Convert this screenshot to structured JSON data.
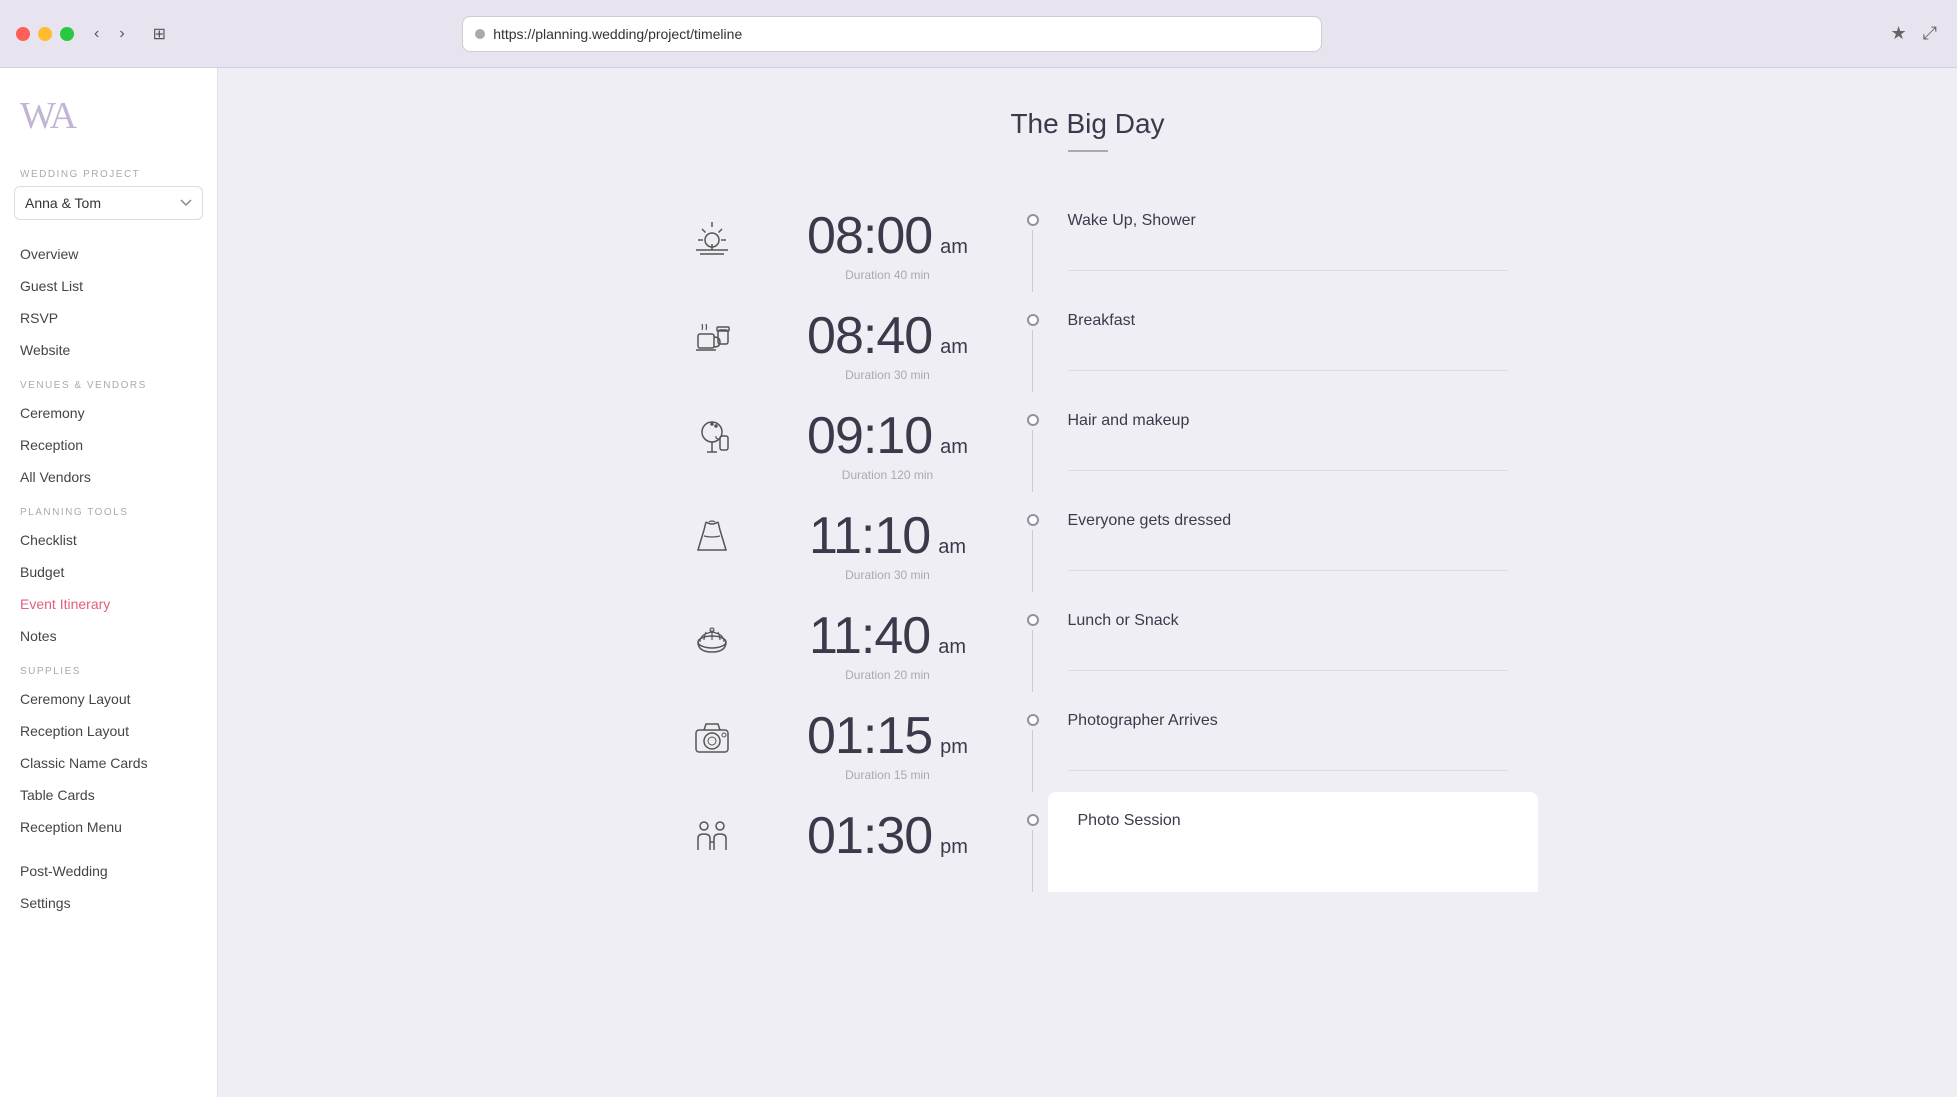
{
  "browser": {
    "url": "https://planning.wedding/project/timeline",
    "bookmark_icon": "★",
    "expand_icon": "⤢"
  },
  "sidebar": {
    "logo_text": "WA",
    "project_section_label": "WEDDING PROJECT",
    "project_name": "Anna & Tom",
    "nav_sections": [
      {
        "items": [
          {
            "id": "overview",
            "label": "Overview",
            "active": false
          },
          {
            "id": "guest-list",
            "label": "Guest List",
            "active": false
          },
          {
            "id": "rsvp",
            "label": "RSVP",
            "active": false
          },
          {
            "id": "website",
            "label": "Website",
            "active": false
          }
        ]
      },
      {
        "label": "VENUES & VENDORS",
        "items": [
          {
            "id": "ceremony",
            "label": "Ceremony",
            "active": false
          },
          {
            "id": "reception",
            "label": "Reception",
            "active": false
          },
          {
            "id": "all-vendors",
            "label": "All Vendors",
            "active": false
          }
        ]
      },
      {
        "label": "PLANNING TOOLS",
        "items": [
          {
            "id": "checklist",
            "label": "Checklist",
            "active": false
          },
          {
            "id": "budget",
            "label": "Budget",
            "active": false
          },
          {
            "id": "event-itinerary",
            "label": "Event Itinerary",
            "active": true
          },
          {
            "id": "notes",
            "label": "Notes",
            "active": false
          }
        ]
      },
      {
        "label": "SUPPLIES",
        "items": [
          {
            "id": "ceremony-layout",
            "label": "Ceremony Layout",
            "active": false
          },
          {
            "id": "reception-layout",
            "label": "Reception Layout",
            "active": false
          },
          {
            "id": "classic-name-cards",
            "label": "Classic Name Cards",
            "active": false
          },
          {
            "id": "table-cards",
            "label": "Table Cards",
            "active": false
          },
          {
            "id": "reception-menu",
            "label": "Reception Menu",
            "active": false
          }
        ]
      },
      {
        "items": [
          {
            "id": "post-wedding",
            "label": "Post-Wedding",
            "active": false
          },
          {
            "id": "settings",
            "label": "Settings",
            "active": false
          }
        ]
      }
    ]
  },
  "page": {
    "title": "The Big Day"
  },
  "timeline": [
    {
      "time": "08:00",
      "ampm": "am",
      "duration": "Duration 40 min",
      "event": "Wake Up, Shower",
      "icon_type": "sunrise"
    },
    {
      "time": "08:40",
      "ampm": "am",
      "duration": "Duration 30 min",
      "event": "Breakfast",
      "icon_type": "breakfast"
    },
    {
      "time": "09:10",
      "ampm": "am",
      "duration": "Duration 120 min",
      "event": "Hair and makeup",
      "icon_type": "makeup"
    },
    {
      "time": "11:10",
      "ampm": "am",
      "duration": "Duration 30 min",
      "event": "Everyone gets dressed",
      "icon_type": "dress"
    },
    {
      "time": "11:40",
      "ampm": "am",
      "duration": "Duration 20 min",
      "event": "Lunch or Snack",
      "icon_type": "lunch"
    },
    {
      "time": "01:15",
      "ampm": "pm",
      "duration": "Duration 15 min",
      "event": "Photographer Arrives",
      "icon_type": "camera"
    },
    {
      "time": "01:30",
      "ampm": "pm",
      "duration": "",
      "event": "Photo Session",
      "icon_type": "photo-session",
      "highlighted": true
    }
  ]
}
